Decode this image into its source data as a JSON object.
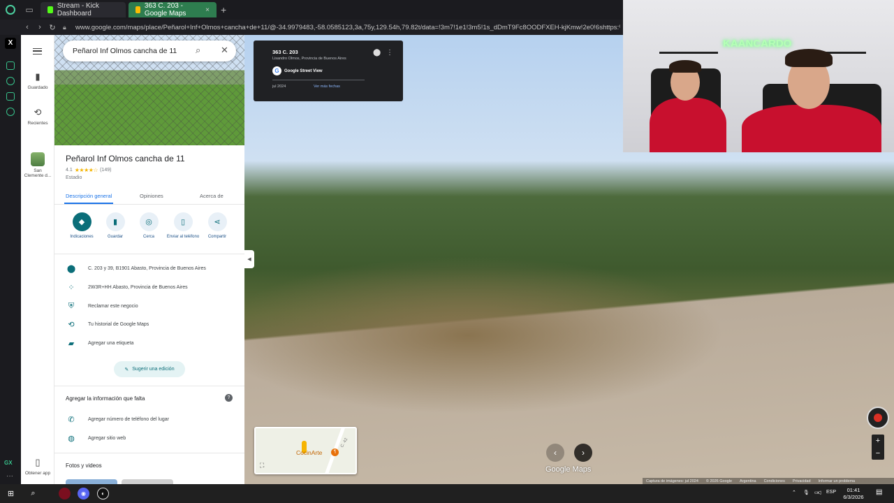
{
  "browser": {
    "tabs": [
      {
        "label": "Stream - Kick Dashboard",
        "favicon_color": "#53fc18"
      },
      {
        "label": "363 C. 203 - Google Maps",
        "favicon_color": "#34a853"
      }
    ],
    "url": "www.google.com/maps/place/Peñarol+Inf+Olmos+cancha+de+11/@-34.9979483,-58.0585123,3a,75y,129.54h,79.82t/data=!3m7!1e1!3m5!1s_dDmT9Fc8OODFXEH-kjKmw!2e0!6shttps:%2F%"
  },
  "sidebar": {
    "items": [
      {
        "label": "Guardado",
        "icon": "bookmark-icon"
      },
      {
        "label": "Recientes",
        "icon": "history-icon"
      },
      {
        "label": "San Clemente d...",
        "icon": "place-thumbnail"
      },
      {
        "label": "Obtener app",
        "icon": "phone-icon"
      }
    ]
  },
  "search": {
    "value": "Peñarol Inf Olmos cancha de 11"
  },
  "place": {
    "title": "Peñarol Inf Olmos cancha de 11",
    "rating": "4.1",
    "stars": "★★★★☆",
    "reviews": "(149)",
    "category": "Estadio",
    "tabs": [
      "Descripción general",
      "Opiniones",
      "Acerca de"
    ],
    "actions": [
      {
        "label": "Indicaciones",
        "icon": "directions-icon"
      },
      {
        "label": "Guardar",
        "icon": "bookmark-icon"
      },
      {
        "label": "Cerca",
        "icon": "nearby-icon"
      },
      {
        "label": "Enviar al teléfono",
        "icon": "send-to-phone-icon"
      },
      {
        "label": "Compartir",
        "icon": "share-icon"
      }
    ],
    "info": [
      {
        "text": "C. 203 y 39, B1901 Abasto, Provincia de Buenos Aires",
        "icon": "location-pin-icon"
      },
      {
        "text": "2W3R+HH Abasto, Provincia de Buenos Aires",
        "icon": "plus-code-icon"
      },
      {
        "text": "Reclamar este negocio",
        "icon": "verified-shield-icon"
      },
      {
        "text": "Tu historial de Google Maps",
        "icon": "history-icon"
      },
      {
        "text": "Agregar una etiqueta",
        "icon": "label-icon"
      }
    ],
    "suggest_edit": "Sugerir una edición",
    "missing_info_title": "Agregar la información que falta",
    "missing_info": [
      {
        "text": "Agregar número de teléfono del lugar",
        "icon": "phone-icon"
      },
      {
        "text": "Agregar sitio web",
        "icon": "globe-icon"
      }
    ],
    "photos_title": "Fotos y videos"
  },
  "streetview": {
    "address": "363 C. 203",
    "locality": "Lisandro Olmos, Provincia de Buenos Aires",
    "provider": "Google Street View",
    "date": "jul 2024",
    "more_dates": "Ver más fechas",
    "minimap_poi": "CocinArte",
    "minimap_road": "C. 42",
    "watermark": "Google Maps",
    "footer": [
      "Captura de imágenes: jul 2024",
      "© 2026 Google",
      "Argentina",
      "Condiciones",
      "Privacidad",
      "Informar un problema"
    ]
  },
  "overlay": {
    "neon_text": "KAANCARDO"
  },
  "taskbar": {
    "lang": "ESP",
    "time": "01:41",
    "date": "6/3/2026"
  }
}
